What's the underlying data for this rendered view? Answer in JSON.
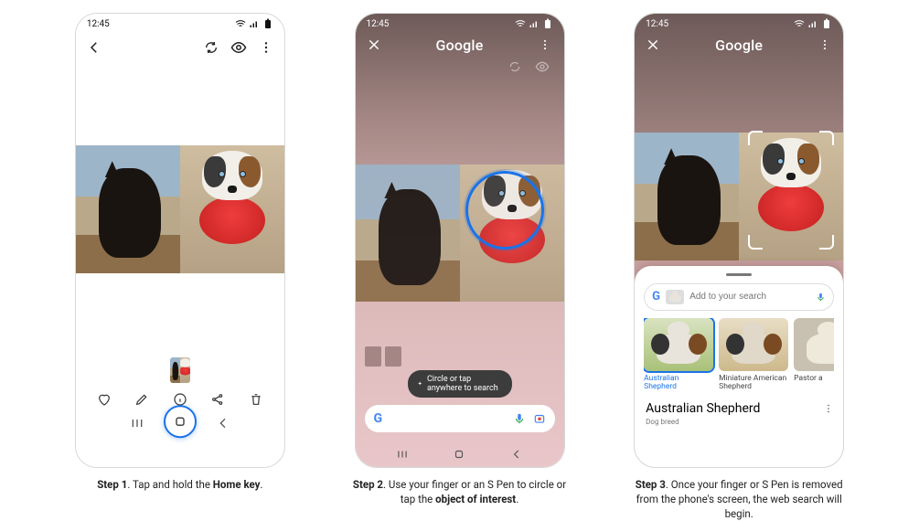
{
  "status": {
    "time": "12:45"
  },
  "step1": {
    "caption_prefix": "Step 1",
    "caption_mid": ". Tap and hold the ",
    "caption_bold2": "Home key",
    "caption_suffix": "."
  },
  "step2": {
    "header_title": "Google",
    "hint": "Circle or tap anywhere to search",
    "caption_prefix": "Step 2",
    "caption_mid": ". Use your finger or an S Pen to circle or tap the ",
    "caption_bold2": "object of interest",
    "caption_suffix": "."
  },
  "step3": {
    "header_title": "Google",
    "search_placeholder": "Add to your search",
    "results": [
      {
        "label": "Australian Shepherd"
      },
      {
        "label": "Miniature American Shepherd"
      },
      {
        "label": "Pastor a"
      }
    ],
    "kp_title": "Australian Shepherd",
    "kp_subtitle": "Dog breed",
    "caption_prefix": "Step 3",
    "caption_text": ". Once your finger or S Pen is removed from the phone's screen, the web search will begin."
  }
}
